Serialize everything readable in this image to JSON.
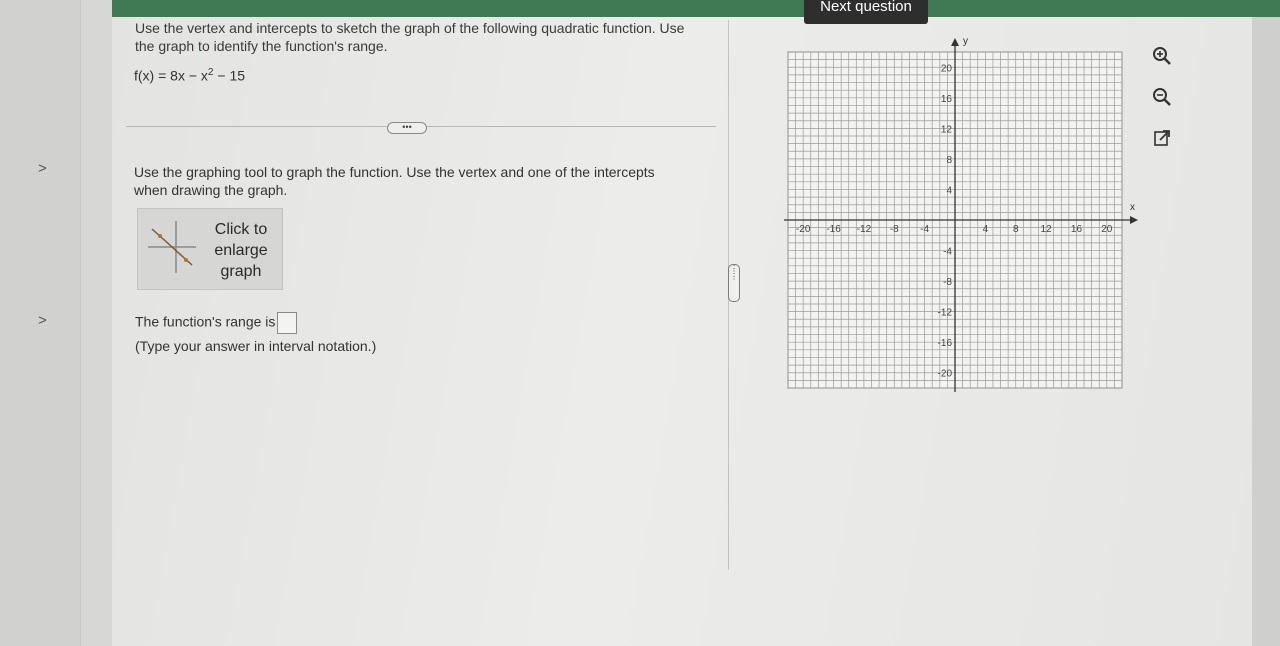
{
  "nav": {
    "next_question": "Next question"
  },
  "question": {
    "prompt": "Use the vertex and intercepts to sketch the graph of the following quadratic function. Use the graph to identify the function's range.",
    "formula_pre": "f(x) = 8x − x",
    "formula_exp": "2",
    "formula_post": " − 15",
    "separator_button": "•••",
    "instruction": "Use the graphing tool to graph the function. Use the vertex and one of the intercepts when drawing the graph.",
    "enlarge_label_1": "Click to",
    "enlarge_label_2": "enlarge",
    "enlarge_label_3": "graph",
    "range_label": "The function's range is",
    "range_value": "",
    "range_hint": "(Type your answer in interval notation.)"
  },
  "graph": {
    "x_axis_label": "x",
    "y_axis_label": "y",
    "x_ticks": [
      "-20",
      "-16",
      "-12",
      "-8",
      "-4",
      "4",
      "8",
      "12",
      "16",
      "20"
    ],
    "y_ticks": [
      "20",
      "16",
      "12",
      "8",
      "4",
      "-4",
      "-8",
      "-12",
      "-16",
      "-20"
    ]
  },
  "tools": {
    "zoom_in": "zoom-in-icon",
    "zoom_out": "zoom-out-icon",
    "popout": "external-link-icon"
  },
  "colors": {
    "accent_green": "#3f7a55",
    "next_button_bg": "#2e2e2e"
  }
}
